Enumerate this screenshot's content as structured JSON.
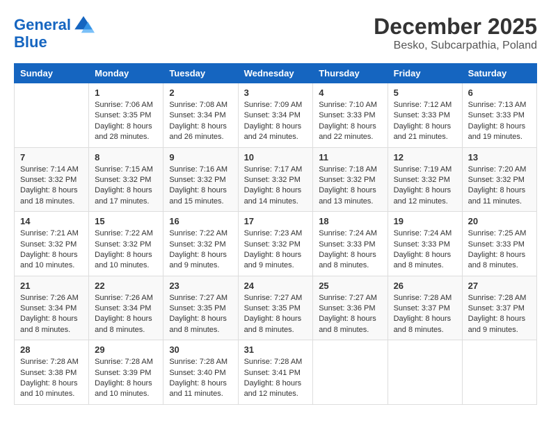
{
  "logo": {
    "line1": "General",
    "line2": "Blue"
  },
  "title": "December 2025",
  "location": "Besko, Subcarpathia, Poland",
  "days_of_week": [
    "Sunday",
    "Monday",
    "Tuesday",
    "Wednesday",
    "Thursday",
    "Friday",
    "Saturday"
  ],
  "weeks": [
    [
      {
        "day": "",
        "info": ""
      },
      {
        "day": "1",
        "info": "Sunrise: 7:06 AM\nSunset: 3:35 PM\nDaylight: 8 hours\nand 28 minutes."
      },
      {
        "day": "2",
        "info": "Sunrise: 7:08 AM\nSunset: 3:34 PM\nDaylight: 8 hours\nand 26 minutes."
      },
      {
        "day": "3",
        "info": "Sunrise: 7:09 AM\nSunset: 3:34 PM\nDaylight: 8 hours\nand 24 minutes."
      },
      {
        "day": "4",
        "info": "Sunrise: 7:10 AM\nSunset: 3:33 PM\nDaylight: 8 hours\nand 22 minutes."
      },
      {
        "day": "5",
        "info": "Sunrise: 7:12 AM\nSunset: 3:33 PM\nDaylight: 8 hours\nand 21 minutes."
      },
      {
        "day": "6",
        "info": "Sunrise: 7:13 AM\nSunset: 3:33 PM\nDaylight: 8 hours\nand 19 minutes."
      }
    ],
    [
      {
        "day": "7",
        "info": "Sunrise: 7:14 AM\nSunset: 3:32 PM\nDaylight: 8 hours\nand 18 minutes."
      },
      {
        "day": "8",
        "info": "Sunrise: 7:15 AM\nSunset: 3:32 PM\nDaylight: 8 hours\nand 17 minutes."
      },
      {
        "day": "9",
        "info": "Sunrise: 7:16 AM\nSunset: 3:32 PM\nDaylight: 8 hours\nand 15 minutes."
      },
      {
        "day": "10",
        "info": "Sunrise: 7:17 AM\nSunset: 3:32 PM\nDaylight: 8 hours\nand 14 minutes."
      },
      {
        "day": "11",
        "info": "Sunrise: 7:18 AM\nSunset: 3:32 PM\nDaylight: 8 hours\nand 13 minutes."
      },
      {
        "day": "12",
        "info": "Sunrise: 7:19 AM\nSunset: 3:32 PM\nDaylight: 8 hours\nand 12 minutes."
      },
      {
        "day": "13",
        "info": "Sunrise: 7:20 AM\nSunset: 3:32 PM\nDaylight: 8 hours\nand 11 minutes."
      }
    ],
    [
      {
        "day": "14",
        "info": "Sunrise: 7:21 AM\nSunset: 3:32 PM\nDaylight: 8 hours\nand 10 minutes."
      },
      {
        "day": "15",
        "info": "Sunrise: 7:22 AM\nSunset: 3:32 PM\nDaylight: 8 hours\nand 10 minutes."
      },
      {
        "day": "16",
        "info": "Sunrise: 7:22 AM\nSunset: 3:32 PM\nDaylight: 8 hours\nand 9 minutes."
      },
      {
        "day": "17",
        "info": "Sunrise: 7:23 AM\nSunset: 3:32 PM\nDaylight: 8 hours\nand 9 minutes."
      },
      {
        "day": "18",
        "info": "Sunrise: 7:24 AM\nSunset: 3:33 PM\nDaylight: 8 hours\nand 8 minutes."
      },
      {
        "day": "19",
        "info": "Sunrise: 7:24 AM\nSunset: 3:33 PM\nDaylight: 8 hours\nand 8 minutes."
      },
      {
        "day": "20",
        "info": "Sunrise: 7:25 AM\nSunset: 3:33 PM\nDaylight: 8 hours\nand 8 minutes."
      }
    ],
    [
      {
        "day": "21",
        "info": "Sunrise: 7:26 AM\nSunset: 3:34 PM\nDaylight: 8 hours\nand 8 minutes."
      },
      {
        "day": "22",
        "info": "Sunrise: 7:26 AM\nSunset: 3:34 PM\nDaylight: 8 hours\nand 8 minutes."
      },
      {
        "day": "23",
        "info": "Sunrise: 7:27 AM\nSunset: 3:35 PM\nDaylight: 8 hours\nand 8 minutes."
      },
      {
        "day": "24",
        "info": "Sunrise: 7:27 AM\nSunset: 3:35 PM\nDaylight: 8 hours\nand 8 minutes."
      },
      {
        "day": "25",
        "info": "Sunrise: 7:27 AM\nSunset: 3:36 PM\nDaylight: 8 hours\nand 8 minutes."
      },
      {
        "day": "26",
        "info": "Sunrise: 7:28 AM\nSunset: 3:37 PM\nDaylight: 8 hours\nand 8 minutes."
      },
      {
        "day": "27",
        "info": "Sunrise: 7:28 AM\nSunset: 3:37 PM\nDaylight: 8 hours\nand 9 minutes."
      }
    ],
    [
      {
        "day": "28",
        "info": "Sunrise: 7:28 AM\nSunset: 3:38 PM\nDaylight: 8 hours\nand 10 minutes."
      },
      {
        "day": "29",
        "info": "Sunrise: 7:28 AM\nSunset: 3:39 PM\nDaylight: 8 hours\nand 10 minutes."
      },
      {
        "day": "30",
        "info": "Sunrise: 7:28 AM\nSunset: 3:40 PM\nDaylight: 8 hours\nand 11 minutes."
      },
      {
        "day": "31",
        "info": "Sunrise: 7:28 AM\nSunset: 3:41 PM\nDaylight: 8 hours\nand 12 minutes."
      },
      {
        "day": "",
        "info": ""
      },
      {
        "day": "",
        "info": ""
      },
      {
        "day": "",
        "info": ""
      }
    ]
  ]
}
